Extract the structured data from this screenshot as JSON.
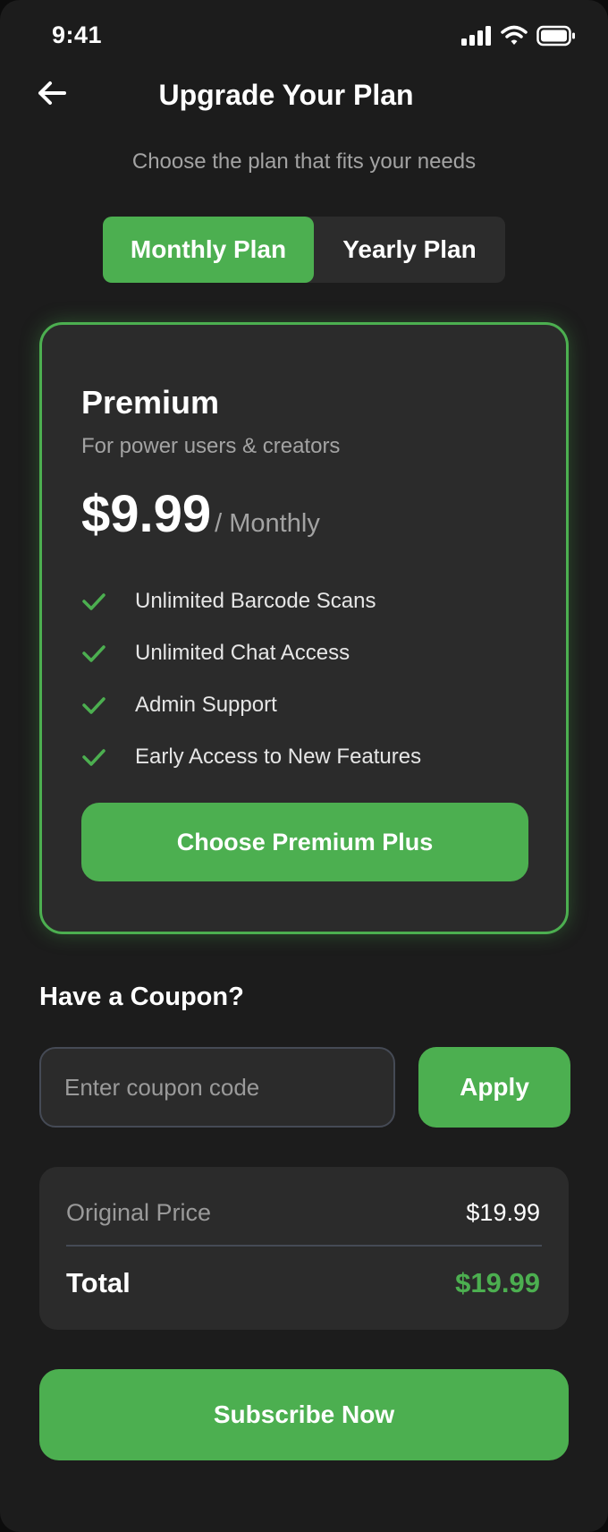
{
  "status_bar": {
    "time": "9:41",
    "icons": [
      "signal-icon",
      "wifi-icon",
      "battery-icon"
    ]
  },
  "header": {
    "back_icon": "arrow-left-icon",
    "title": "Upgrade Your Plan",
    "subtitle": "Choose the plan that fits your needs"
  },
  "plan_toggle": {
    "tabs": [
      {
        "label": "Monthly Plan",
        "selected": true
      },
      {
        "label": "Yearly Plan",
        "selected": false
      }
    ]
  },
  "plan_card": {
    "name": "Premium",
    "description": "For power users & creators",
    "price": "$9.99",
    "period": "/ Monthly",
    "features": [
      "Unlimited Barcode Scans",
      "Unlimited Chat Access",
      "Admin Support",
      "Early Access to New Features"
    ],
    "cta_label": "Choose Premium Plus"
  },
  "coupon": {
    "heading": "Have a Coupon?",
    "placeholder": "Enter coupon code",
    "value": "",
    "apply_label": "Apply"
  },
  "summary": {
    "original_label": "Original Price",
    "original_value": "$19.99",
    "total_label": "Total",
    "total_value": "$19.99"
  },
  "footer": {
    "subscribe_label": "Subscribe Now"
  },
  "colors": {
    "accent": "#4caf50",
    "background": "#1c1c1c",
    "card": "#2b2b2b",
    "muted_text": "#a3a3a3"
  }
}
